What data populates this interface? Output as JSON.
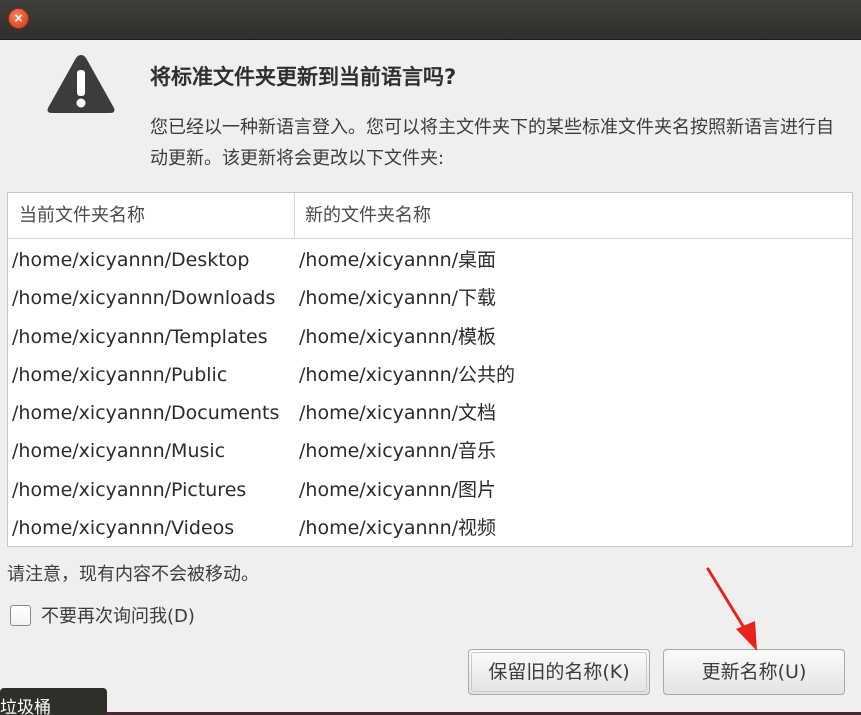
{
  "window": {
    "close_glyph": "×"
  },
  "dialog": {
    "heading": "将标准文件夹更新到当前语言吗?",
    "message": "您已经以一种新语言登入。您可以将主文件夹下的某些标准文件夹名按照新语言进行自动更新。该更新将会更改以下文件夹:",
    "icon": "warning-icon"
  },
  "table": {
    "headers": [
      "当前文件夹名称",
      "新的文件夹名称"
    ],
    "rows": [
      [
        "/home/xicyannn/Desktop",
        "/home/xicyannn/桌面"
      ],
      [
        "/home/xicyannn/Downloads",
        "/home/xicyannn/下载"
      ],
      [
        "/home/xicyannn/Templates",
        "/home/xicyannn/模板"
      ],
      [
        "/home/xicyannn/Public",
        "/home/xicyannn/公共的"
      ],
      [
        "/home/xicyannn/Documents",
        "/home/xicyannn/文档"
      ],
      [
        "/home/xicyannn/Music",
        "/home/xicyannn/音乐"
      ],
      [
        "/home/xicyannn/Pictures",
        "/home/xicyannn/图片"
      ],
      [
        "/home/xicyannn/Videos",
        "/home/xicyannn/视频"
      ]
    ]
  },
  "note": "请注意，现有内容不会被移动。",
  "dont_ask": {
    "label": "不要再次询问我(D)",
    "checked": false
  },
  "buttons": {
    "keep": "保留旧的名称(K)",
    "update": "更新名称(U)"
  },
  "taskbar": {
    "tooltip": "垃圾桶"
  },
  "colors": {
    "close": "#e65530",
    "annotation_arrow": "#e8231c",
    "titlebar": "#3a3935"
  }
}
